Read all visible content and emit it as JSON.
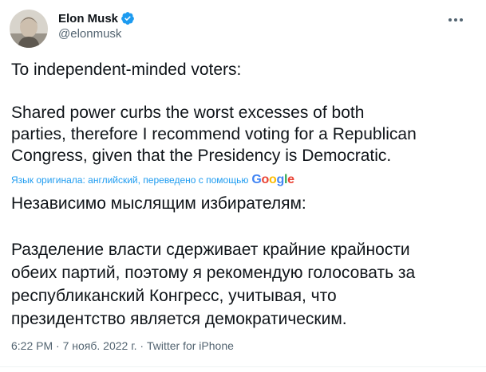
{
  "author": {
    "display_name": "Elon Musk",
    "handle": "@elonmusk",
    "verified": true,
    "avatar_icon": "avatar-photo"
  },
  "tweet": {
    "original_lines": [
      "To independent-minded voters:",
      "",
      "Shared power curbs the worst excesses of both",
      "parties, therefore I recommend voting for a Republican",
      "Congress, given that the Presidency is Democratic."
    ],
    "translation_note": "Язык оригинала: английский, переведено с помощью",
    "translation_provider": "Google",
    "translated_lines": [
      "Независимо мыслящим избирателям:",
      "",
      "Разделение власти сдерживает крайние крайности",
      "обеих партий, поэтому я рекомендую голосовать за",
      "республиканский Конгресс, учитывая, что",
      "президентство является демократическим."
    ]
  },
  "meta": {
    "time": "6:22 PM",
    "separator": " · ",
    "date": "7 нояб. 2022 г.",
    "source": "Twitter for iPhone"
  },
  "colors": {
    "verified_badge": "#1d9bf0",
    "link": "#1d9bf0",
    "secondary_text": "#536471"
  },
  "icons": [
    "verified-badge-icon",
    "more-options-icon",
    "google-logo"
  ]
}
